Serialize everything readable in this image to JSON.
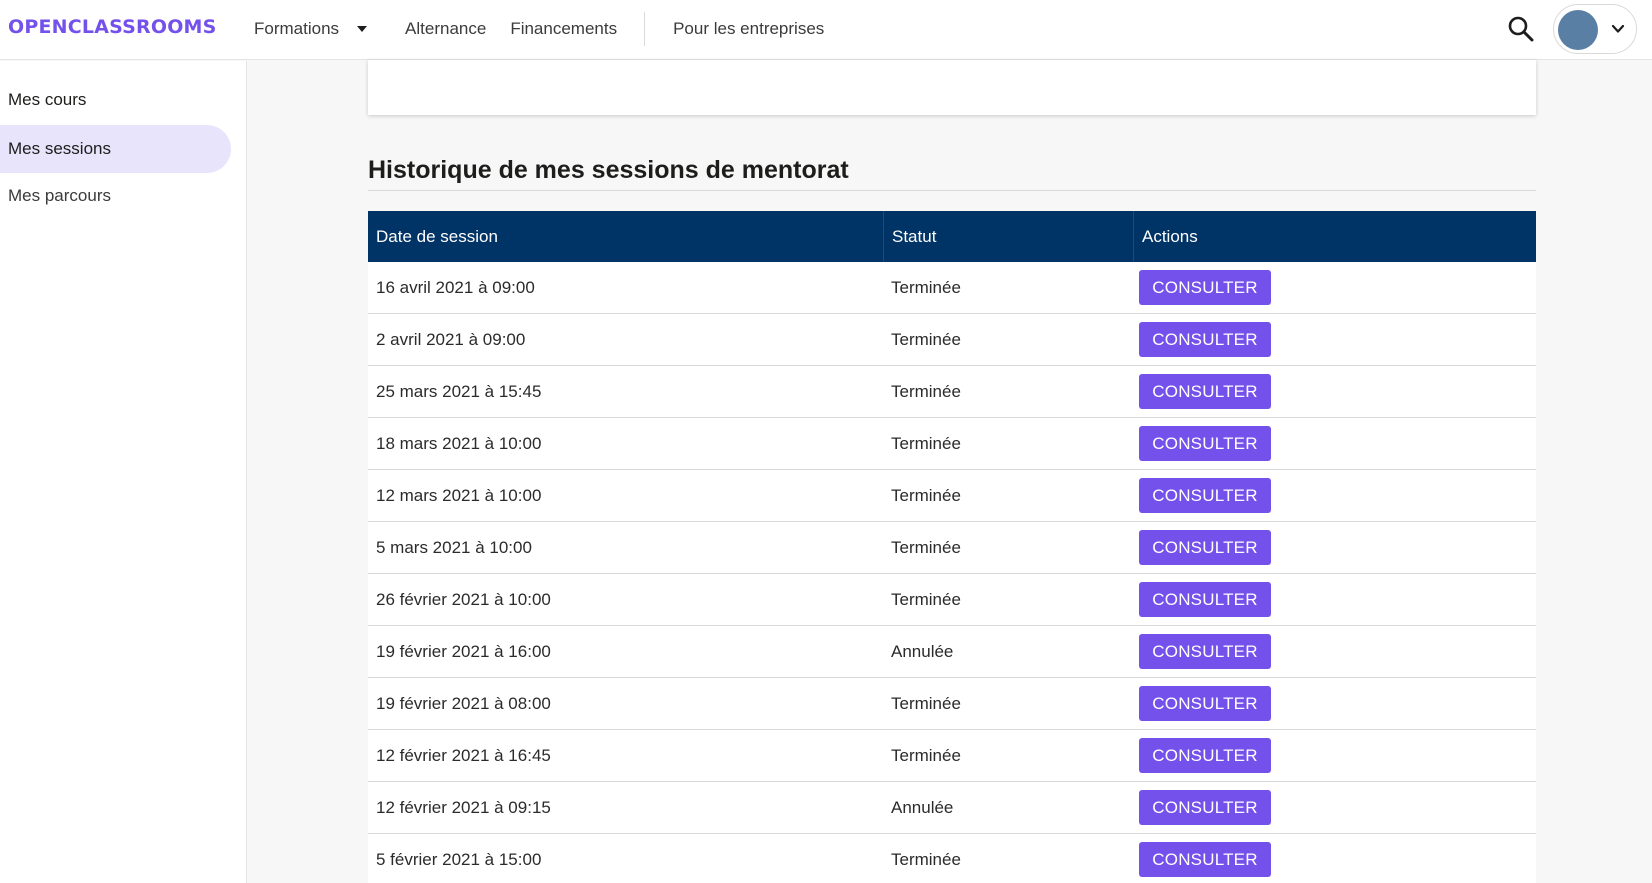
{
  "header": {
    "logo": "OPENCLASSROOMS",
    "nav": {
      "formations": "Formations",
      "alternance": "Alternance",
      "financements": "Financements",
      "entreprises": "Pour les entreprises"
    }
  },
  "sidebar": {
    "items": [
      {
        "label": "Mes cours"
      },
      {
        "label": "Mes sessions"
      },
      {
        "label": "Mes parcours"
      }
    ]
  },
  "main": {
    "section_title": "Historique de mes sessions de mentorat",
    "table": {
      "headers": [
        "Date de session",
        "Statut",
        "Actions"
      ],
      "rows": [
        {
          "date": "16 avril 2021 à 09:00",
          "status": "Terminée",
          "action": "CONSULTER"
        },
        {
          "date": "2 avril 2021 à 09:00",
          "status": "Terminée",
          "action": "CONSULTER"
        },
        {
          "date": "25 mars 2021 à 15:45",
          "status": "Terminée",
          "action": "CONSULTER"
        },
        {
          "date": "18 mars 2021 à 10:00",
          "status": "Terminée",
          "action": "CONSULTER"
        },
        {
          "date": "12 mars 2021 à 10:00",
          "status": "Terminée",
          "action": "CONSULTER"
        },
        {
          "date": "5 mars 2021 à 10:00",
          "status": "Terminée",
          "action": "CONSULTER"
        },
        {
          "date": "26 février 2021 à 10:00",
          "status": "Terminée",
          "action": "CONSULTER"
        },
        {
          "date": "19 février 2021 à 16:00",
          "status": "Annulée",
          "action": "CONSULTER"
        },
        {
          "date": "19 février 2021 à 08:00",
          "status": "Terminée",
          "action": "CONSULTER"
        },
        {
          "date": "12 février 2021 à 16:45",
          "status": "Terminée",
          "action": "CONSULTER"
        },
        {
          "date": "12 février 2021 à 09:15",
          "status": "Annulée",
          "action": "CONSULTER"
        },
        {
          "date": "5 février 2021 à 15:00",
          "status": "Terminée",
          "action": "CONSULTER"
        }
      ]
    }
  },
  "colors": {
    "brand": "#7451eb",
    "table_header": "#003366",
    "sidebar_active": "#e8e4fb"
  },
  "icons": {
    "search": "search-icon",
    "user_menu_chevron": "chevron-down-icon",
    "formations_caret": "caret-down-icon"
  }
}
